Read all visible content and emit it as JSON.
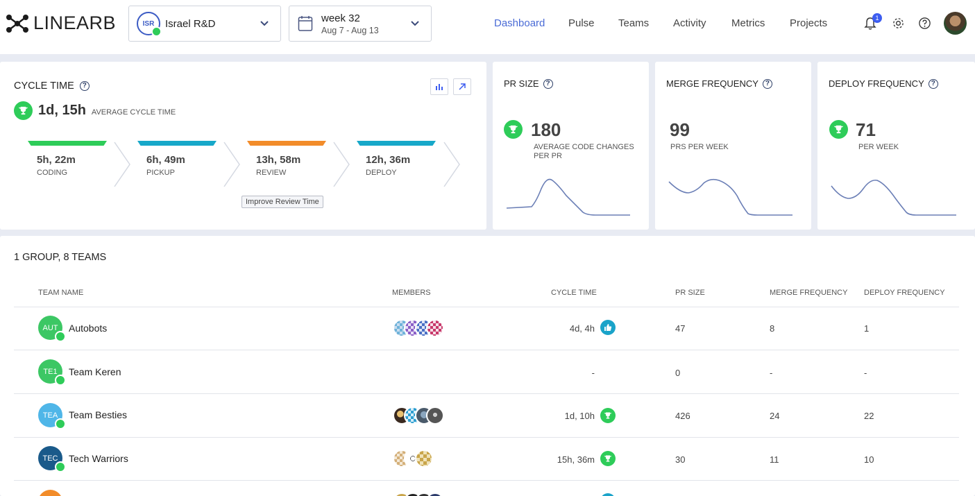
{
  "header": {
    "logo": "LINEARB",
    "org": {
      "badge": "ISR",
      "name": "Israel R&D"
    },
    "week": {
      "title": "week 32",
      "range": "Aug 7 - Aug 13"
    },
    "nav": [
      "Dashboard",
      "Pulse",
      "Teams",
      "Activity",
      "Metrics",
      "Projects"
    ],
    "active_nav": "Dashboard",
    "notification_count": "1",
    "accent": "#4a6bd6"
  },
  "cycle_time": {
    "title": "CYCLE TIME",
    "value": "1d, 15h",
    "caption": "AVERAGE CYCLE TIME",
    "stages": [
      {
        "value": "5h, 22m",
        "label": "CODING",
        "color": "#2ecc59"
      },
      {
        "value": "6h, 49m",
        "label": "PICKUP",
        "color": "#17a8c9"
      },
      {
        "value": "13h, 58m",
        "label": "REVIEW",
        "color": "#f28c2a"
      },
      {
        "value": "12h, 36m",
        "label": "DEPLOY",
        "color": "#17a8c9"
      }
    ],
    "improve_label": "Improve Review Time"
  },
  "pr_size": {
    "title": "PR SIZE",
    "value": "180",
    "caption": "AVERAGE CODE CHANGES PER PR"
  },
  "merge_frequency": {
    "title": "MERGE FREQUENCY",
    "value": "99",
    "caption": "PRS PER WEEK"
  },
  "deploy_frequency": {
    "title": "DEPLOY FREQUENCY",
    "value": "71",
    "caption": "PER WEEK"
  },
  "teams_table": {
    "title": "1 GROUP, 8 TEAMS",
    "columns": [
      "TEAM NAME",
      "MEMBERS",
      "CYCLE TIME",
      "PR SIZE",
      "MERGE FREQUENCY",
      "DEPLOY FREQUENCY"
    ],
    "rows": [
      {
        "badge": "AUT",
        "color": "#3cc764",
        "name": "Autobots",
        "cycle": "4d, 4h",
        "cycle_icon": "thumbs-up-icon",
        "pr": "47",
        "merge": "8",
        "deploy": "1"
      },
      {
        "badge": "TE1",
        "color": "#3cc764",
        "name": "Team Keren",
        "cycle": "-",
        "cycle_icon": "",
        "pr": "0",
        "merge": "-",
        "deploy": "-"
      },
      {
        "badge": "TEA",
        "color": "#4fb6e8",
        "name": "Team Besties",
        "cycle": "1d, 10h",
        "cycle_icon": "trophy-icon",
        "pr": "426",
        "merge": "24",
        "deploy": "22"
      },
      {
        "badge": "TEC",
        "color": "#1a5a8a",
        "name": "Tech Warriors",
        "cycle": "15h, 36m",
        "cycle_icon": "trophy-icon",
        "pr": "30",
        "merge": "11",
        "deploy": "10"
      }
    ]
  }
}
